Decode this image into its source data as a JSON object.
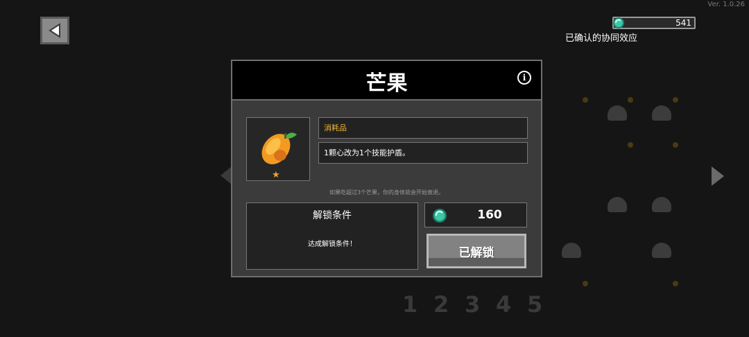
{
  "hud": {
    "version": "Ver. 1.0.26",
    "gem_count": "541",
    "synergy_label": "已确认的协同效应"
  },
  "modal": {
    "title": "芒果",
    "info_icon": "info-icon",
    "category": "消耗品",
    "description": "1颗心改为1个技能护盾。",
    "flavor_text": "如果吃超过3个芒果，你的身体就会开始衰退。",
    "unlock_condition": {
      "title": "解锁条件",
      "text": "达成解锁条件！"
    },
    "price": "160",
    "button_label": "已解锁"
  },
  "background": {
    "page_numbers": [
      "1",
      "2",
      "3",
      "4",
      "5"
    ]
  },
  "colors": {
    "category_text": "#f3b733",
    "gem": "#3bc9a6",
    "star": "#f4a12c"
  }
}
